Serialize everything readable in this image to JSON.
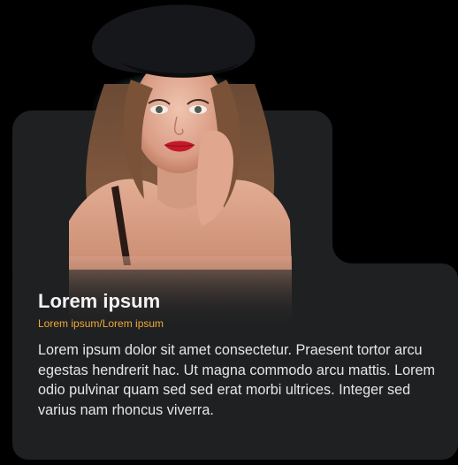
{
  "card": {
    "title": "Lorem ipsum",
    "subtitle": "Lorem ipsum/Lorem ipsum",
    "body": "Lorem ipsum dolor sit amet consectetur. Praesent tortor arcu egestas hendrerit hac. Ut magna commodo arcu mattis. Lorem odio pulvinar quam sed sed erat morbi ultrices. Integer sed varius nam rhoncus viverra."
  },
  "colors": {
    "background": "#000000",
    "card": "#1f2021",
    "title": "#f2f2f2",
    "subtitle_accent": "#f0a93a",
    "body_text": "#e6e6e6"
  },
  "image": {
    "subject": "portrait-woman-black-beret"
  }
}
